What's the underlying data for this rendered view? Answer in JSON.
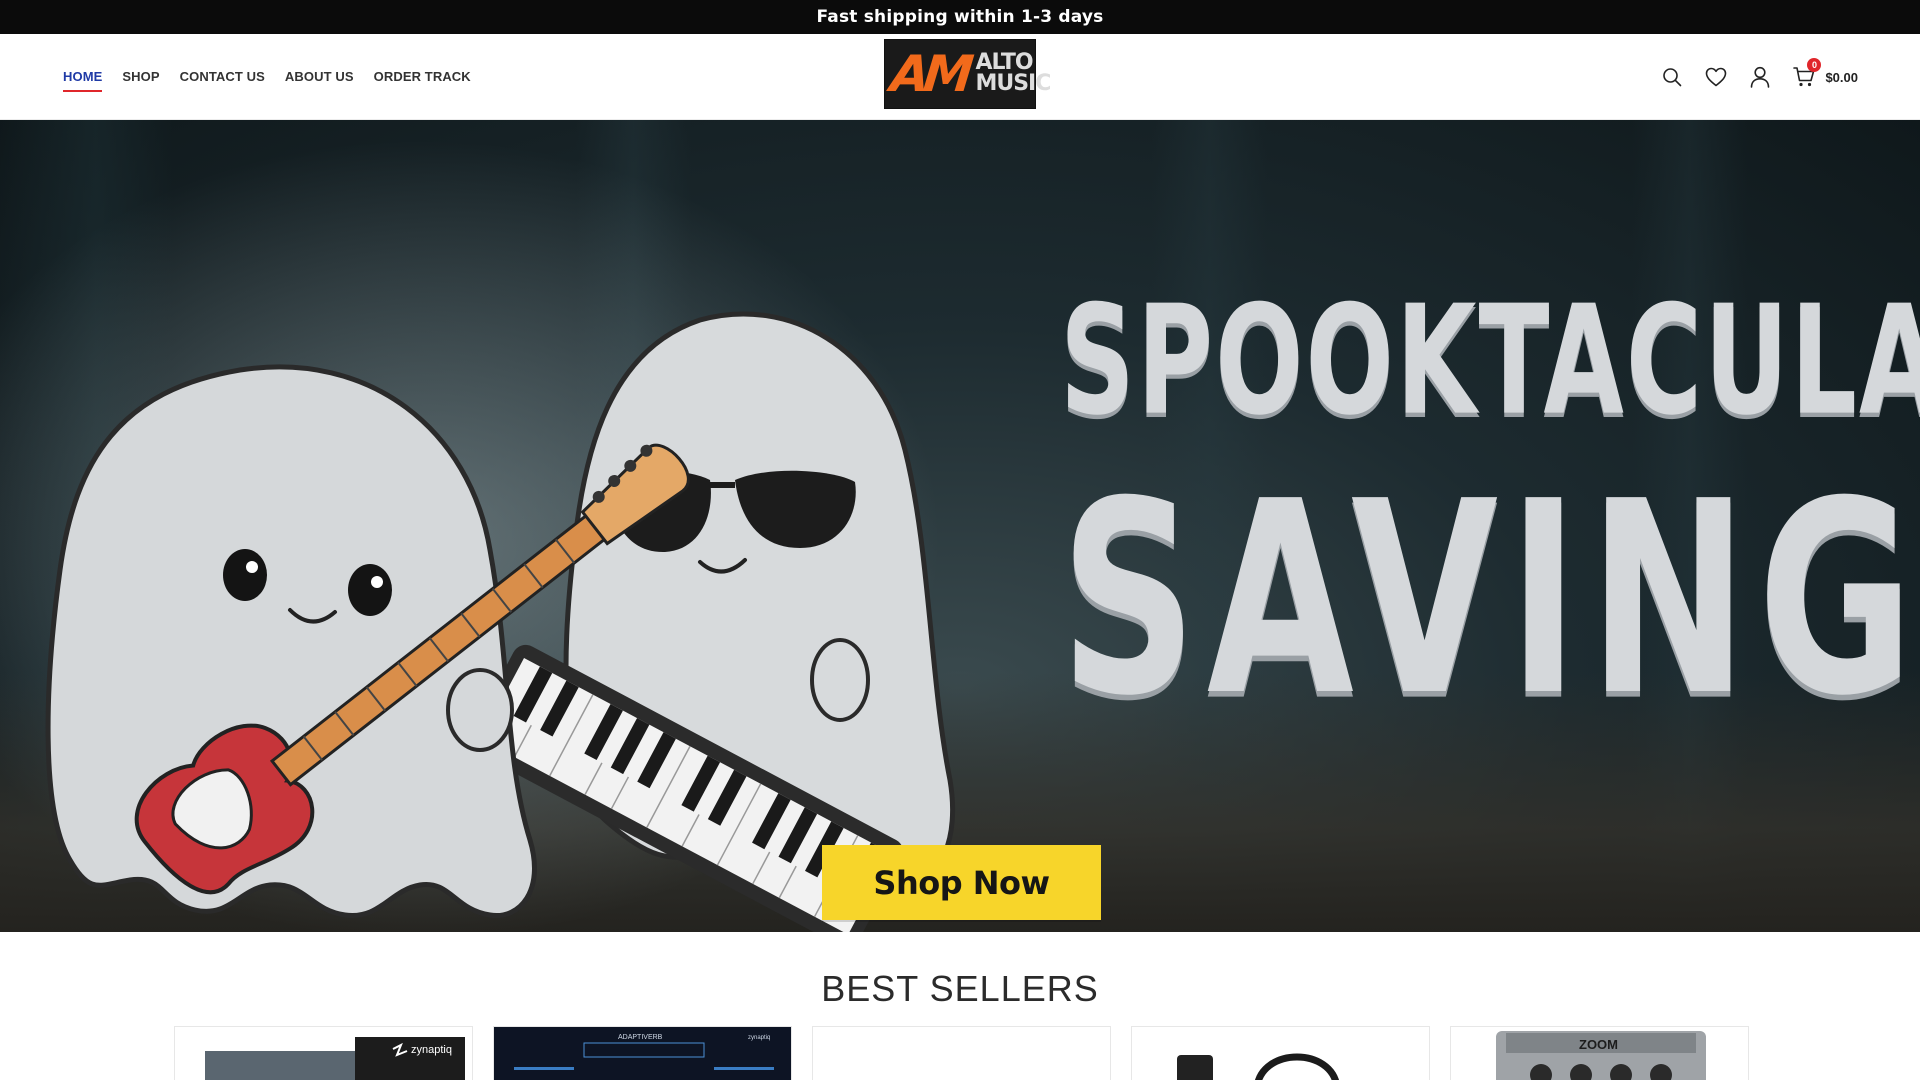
{
  "announcement": {
    "text": "Fast shipping within 1-3 days"
  },
  "nav": {
    "items": [
      {
        "label": "HOME",
        "active": true
      },
      {
        "label": "SHOP",
        "active": false
      },
      {
        "label": "CONTACT US",
        "active": false
      },
      {
        "label": "ABOUT US",
        "active": false
      },
      {
        "label": "ORDER TRACK",
        "active": false
      }
    ]
  },
  "logo": {
    "monogram": "AM",
    "line1": "ALTO",
    "line2": "MUSIC"
  },
  "header_tools": {
    "icons": [
      "search-icon",
      "heart-icon",
      "user-icon",
      "cart-icon"
    ],
    "cart_count": "0",
    "cart_total": "$0.00"
  },
  "hero": {
    "headline_line1": "SPOOKTACULAR",
    "headline_line2": "SAVINGS",
    "cta_label": "Shop Now",
    "colors": {
      "cta": "#f7d52a",
      "headline": "#d5d8db",
      "background": "#1d2b30"
    }
  },
  "best_sellers": {
    "title": "BEST SELLERS",
    "products": [
      {
        "brand": "zynaptiq"
      },
      {
        "brand": "zynaptiq",
        "label": "ADAPTIVERB"
      },
      {
        "brand": ""
      },
      {
        "brand": ""
      },
      {
        "brand": "ZOOM"
      }
    ]
  },
  "colors": {
    "topbar": "#0b0b0b",
    "nav_active": "#1f3aa6",
    "accent_red": "#e0262b"
  }
}
